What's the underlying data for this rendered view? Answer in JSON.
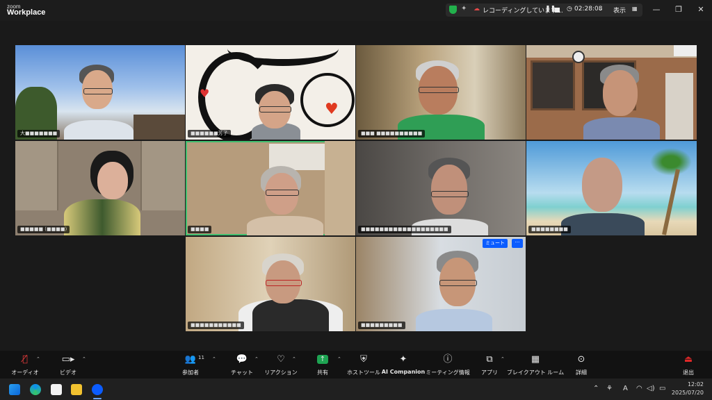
{
  "app": {
    "logo_top": "zoom",
    "logo_bottom": "Workplace"
  },
  "recording": {
    "status": "レコーディングしています...",
    "elapsed": "02:28:08",
    "view_label": "表示"
  },
  "participants": [
    {
      "name": "大■■■■■■■"
    },
    {
      "name": "■■■■■■芳子"
    },
    {
      "name": "■■■ ■■■■■■■■■■"
    },
    {
      "name": ""
    },
    {
      "name": "■■■■■ (■■■■)"
    },
    {
      "name": "■■■■"
    },
    {
      "name": "■■■■■■■■■■■■■■■■■■■"
    },
    {
      "name": "■■■■■■■■"
    },
    {
      "name": "■■■■■■■■■■■"
    },
    {
      "name": "■■■■■■■■■"
    }
  ],
  "tile_overlay": {
    "mute_button": "ミュート",
    "more_button": "···"
  },
  "toolbar": {
    "audio": "オーディオ",
    "video": "ビデオ",
    "participants": "参加者",
    "participants_count": "11",
    "chat": "チャット",
    "reactions": "リアクション",
    "share": "共有",
    "host_tools": "ホストツール",
    "ai_companion": "AI Companion",
    "meeting_info": "ミーティング情報",
    "apps": "アプリ",
    "layout_rooms": "ブレイクアウト ルーム",
    "more": "詳細",
    "leave": "退出"
  },
  "taskbar": {
    "time": "12:02",
    "date": "2025/07/20",
    "ime": "A"
  },
  "colors": {
    "active_speaker": "#3fbf6f",
    "accent_blue": "#0b5cff",
    "leave_red": "#e02828",
    "share_green": "#1ea352"
  }
}
